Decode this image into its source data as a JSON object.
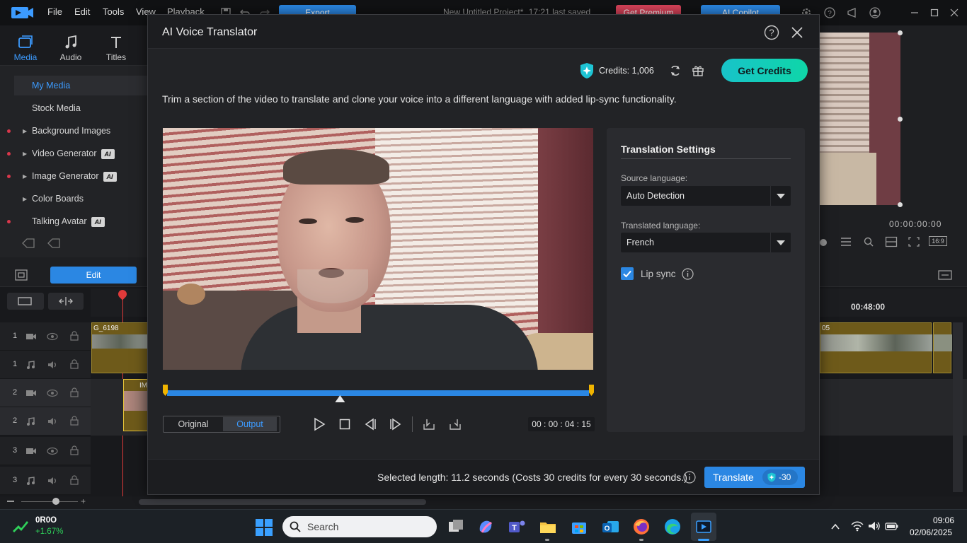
{
  "app": {
    "menu": [
      "File",
      "Edit",
      "Tools",
      "View",
      "Playback"
    ],
    "export_label": "Export",
    "project_title": "New Untitled Project*",
    "last_saved": "17:21 last saved",
    "premium_label": "Get Premium",
    "copilot_label": "AI Copilot",
    "media_tabs": [
      {
        "label": "Media",
        "icon": "media-icon"
      },
      {
        "label": "Audio",
        "icon": "music-note-icon"
      },
      {
        "label": "Titles",
        "icon": "text-t-icon"
      }
    ],
    "library": [
      {
        "label": "My Media",
        "active": true
      },
      {
        "label": "Stock Media"
      },
      {
        "label": "Background Images"
      },
      {
        "label": "Video Generator",
        "ai": "AI"
      },
      {
        "label": "Image Generator",
        "ai": "AI"
      },
      {
        "label": "Color Boards"
      },
      {
        "label": "Talking Avatar",
        "ai": "AI"
      }
    ],
    "edit_label": "Edit",
    "preview_time": "00:00:00:00",
    "aspect_ratio": "16:9",
    "ruler_time": "00:48:00",
    "clip_name_1": "G_6198",
    "clip_name_2": "IM",
    "clip_name_3": "05",
    "tracks": [
      "1",
      "1",
      "2",
      "2",
      "3",
      "3"
    ]
  },
  "dialog": {
    "title": "AI Voice Translator",
    "credits_label": "Credits: 1,006",
    "get_credits_label": "Get Credits",
    "description": "Trim a section of the video to translate and clone your voice into a different language with added lip-sync functionality.",
    "toggle": {
      "original": "Original",
      "output": "Output",
      "selected": "output"
    },
    "timecode": "00 : 00 : 04 : 15",
    "settings": {
      "title": "Translation Settings",
      "source_label": "Source language:",
      "source_value": "Auto Detection",
      "target_label": "Translated language:",
      "target_value": "French",
      "lipsync_label": "Lip sync",
      "lipsync_checked": true
    },
    "footer": {
      "selected_length": "Selected length: 11.2 seconds (Costs 30 credits for every 30 seconds.)",
      "translate_label": "Translate",
      "cost_label": "-30"
    },
    "accent": "#2b87e3",
    "scrub_playhead_fraction": 0.41
  },
  "taskbar": {
    "stock_name": "0R0O",
    "stock_change": "+1.67%",
    "search_placeholder": "Search",
    "time": "09:06",
    "date": "02/06/2025"
  }
}
